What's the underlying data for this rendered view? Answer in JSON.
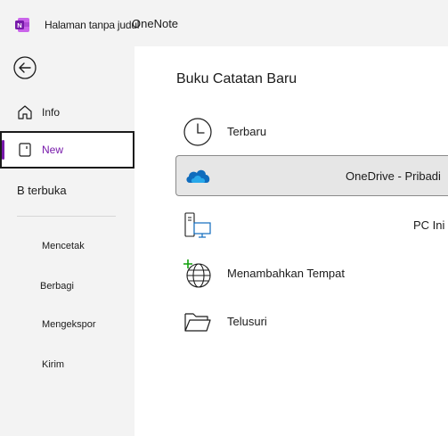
{
  "titlebar": {
    "doc_title": "Halaman tanpa judul",
    "app_name": "OneNote"
  },
  "sidebar": {
    "info_label": "Info",
    "new_label": "New",
    "open_label": "B terbuka",
    "print_label": "Mencetak",
    "share_label": "Berbagi",
    "export_label": "Mengekspor",
    "send_label": "Kirim"
  },
  "main": {
    "title": "Buku Catatan Baru",
    "locations": {
      "recent": "Terbaru",
      "onedrive": "OneDrive - Pribadi",
      "pc": "PC Ini",
      "add_place": "Menambahkan Tempat",
      "browse": "Telusuri"
    }
  },
  "colors": {
    "accent": "#7719aa",
    "onedrive_blue": "#0f6cbd",
    "selected_bg": "#e6e6e6"
  }
}
